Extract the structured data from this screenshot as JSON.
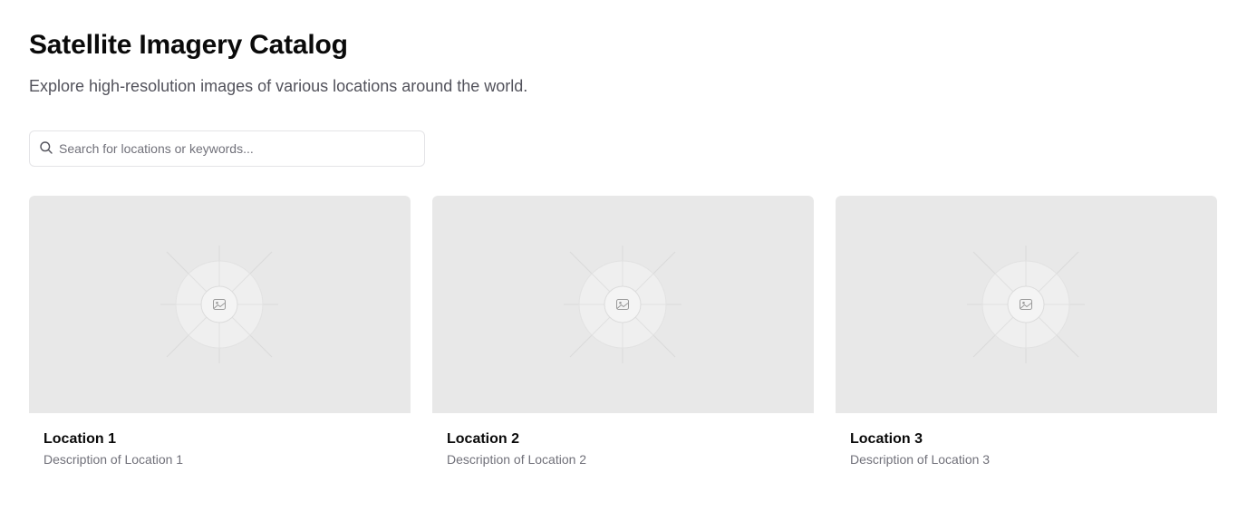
{
  "header": {
    "title": "Satellite Imagery Catalog",
    "subtitle": "Explore high-resolution images of various locations around the world."
  },
  "search": {
    "placeholder": "Search for locations or keywords...",
    "value": "",
    "icon": "search-icon"
  },
  "cards": [
    {
      "title": "Location 1",
      "description": "Description of Location 1",
      "image_icon": "image-placeholder-icon"
    },
    {
      "title": "Location 2",
      "description": "Description of Location 2",
      "image_icon": "image-placeholder-icon"
    },
    {
      "title": "Location 3",
      "description": "Description of Location 3",
      "image_icon": "image-placeholder-icon"
    }
  ],
  "colors": {
    "image_placeholder_bg": "#e8e8e8",
    "muted_text": "#71717a",
    "border": "#e4e4e7"
  }
}
